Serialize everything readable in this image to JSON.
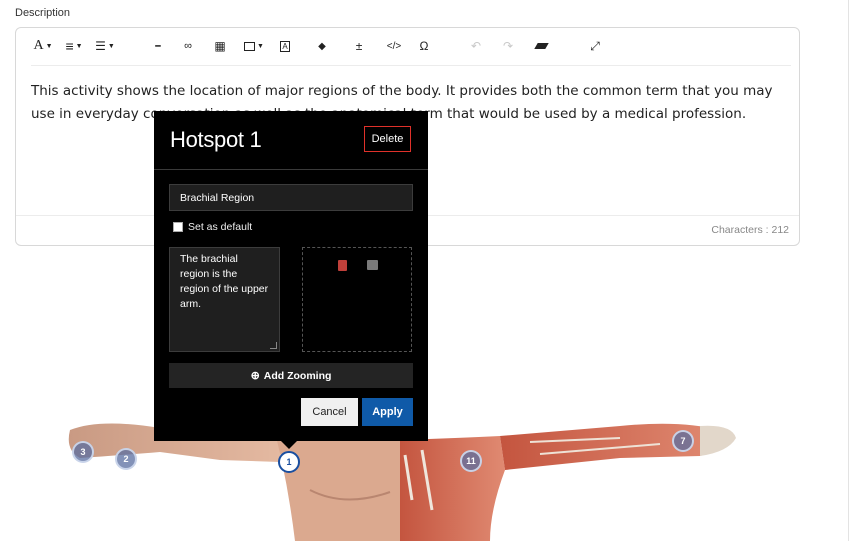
{
  "description_label": "Description",
  "editor": {
    "toolbar": {
      "font": "A",
      "align": "≡",
      "list": "☰",
      "hr": "━",
      "link": "🔗",
      "table": "▦",
      "image": "🖼",
      "text_box": "A",
      "highlight": "◆",
      "formula": "±",
      "code": "</>",
      "special_char": "Ω",
      "undo": "↶",
      "redo": "↷",
      "eraser": "⌫",
      "fullscreen": "⤢"
    },
    "content": "This activity shows the location of major regions of the body. It provides both the common term that you may use in everyday conversation as well as the anatomical term that would be used by a medical profession.",
    "char_count": "Characters : 212"
  },
  "popup": {
    "title": "Hotspot 1",
    "delete_label": "Delete",
    "name_value": "Brachial Region",
    "default_label": "Set as default",
    "description_value": "The brachial region is the region of the upper arm.",
    "zoom_label": "Add Zooming",
    "cancel_label": "Cancel",
    "apply_label": "Apply"
  },
  "hotspots": [
    "1",
    "2",
    "3",
    "7",
    "11"
  ],
  "colors": {
    "accent": "#0f5aa8",
    "delete_border": "#e0312a",
    "popup_bg": "#000000"
  }
}
